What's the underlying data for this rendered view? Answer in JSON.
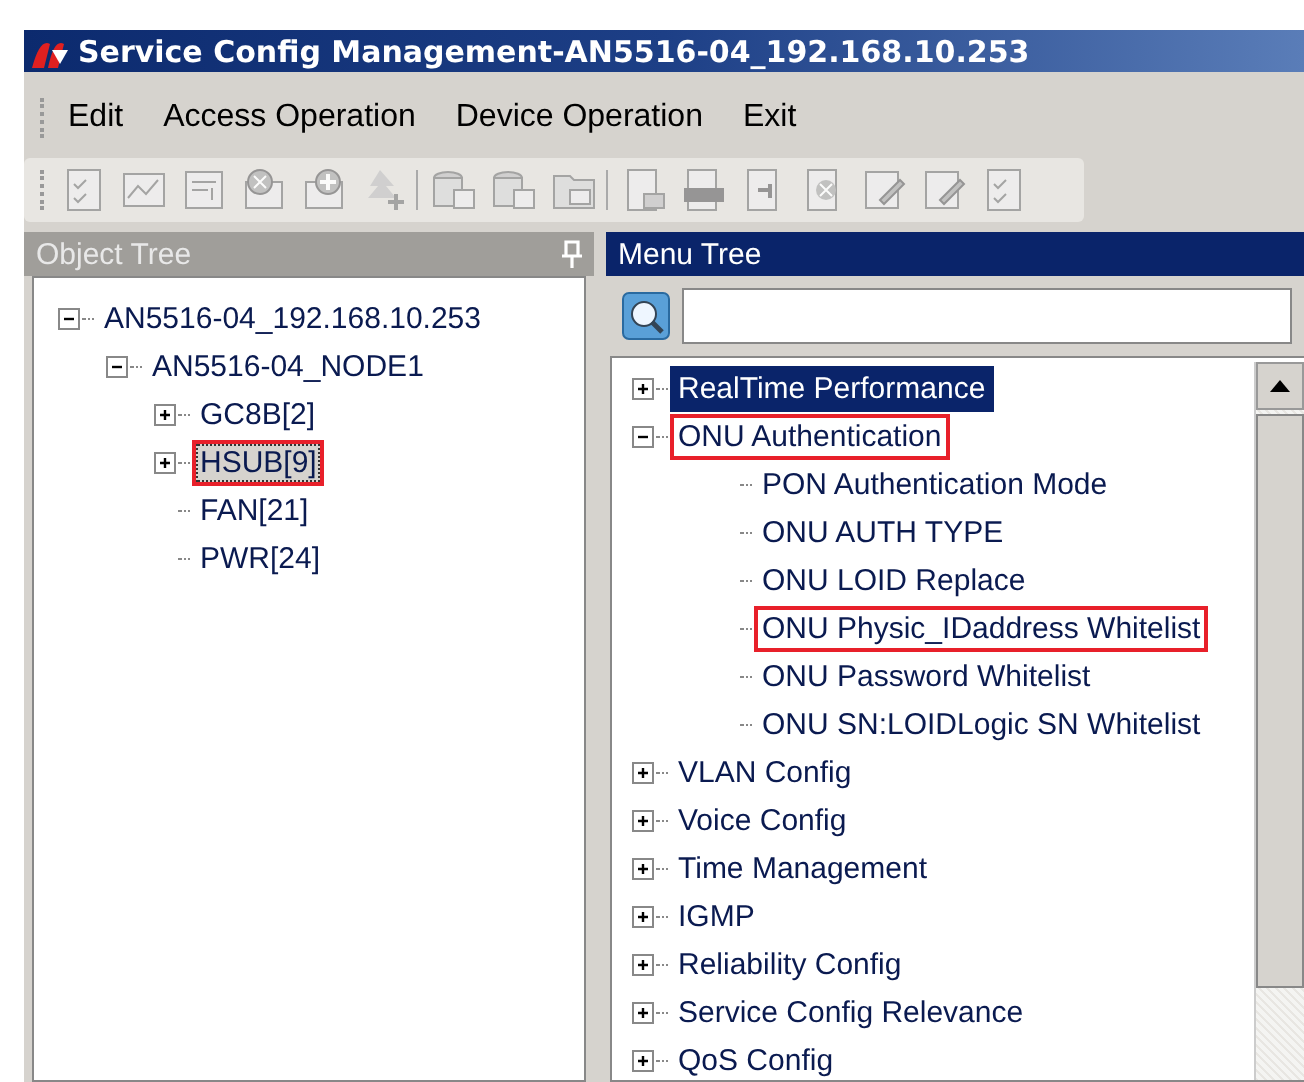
{
  "window": {
    "title": "Service Config Management-AN5516-04_192.168.10.253"
  },
  "menu": [
    "Edit",
    "Access Operation",
    "Device Operation",
    "Exit"
  ],
  "object_tree": {
    "title": "Object Tree",
    "active": false,
    "items": [
      {
        "label": "AN5516-04_192.168.10.253",
        "expanded": true,
        "selected": false,
        "marked": false,
        "children": [
          {
            "label": "AN5516-04_NODE1",
            "expanded": true,
            "selected": false,
            "marked": false,
            "children": [
              {
                "label": "GC8B[2]",
                "expanded": false,
                "selected": false,
                "marked": false
              },
              {
                "label": "HSUB[9]",
                "expanded": false,
                "selected": true,
                "marked": true
              },
              {
                "label": "FAN[21]",
                "selected": false,
                "marked": false
              },
              {
                "label": "PWR[24]",
                "selected": false,
                "marked": false
              }
            ]
          }
        ]
      }
    ]
  },
  "menu_tree": {
    "title": "Menu Tree",
    "active": true,
    "items": [
      {
        "label": "RealTime Performance",
        "expanded": false,
        "selected": true,
        "marked": false
      },
      {
        "label": "ONU Authentication",
        "expanded": true,
        "selected": false,
        "marked": true,
        "children": [
          {
            "label": "PON Authentication Mode",
            "selected": false,
            "marked": false
          },
          {
            "label": "ONU AUTH TYPE",
            "selected": false,
            "marked": false
          },
          {
            "label": "ONU LOID Replace",
            "selected": false,
            "marked": false
          },
          {
            "label": "ONU Physic_IDaddress Whitelist",
            "selected": false,
            "marked": true
          },
          {
            "label": "ONU Password Whitelist",
            "selected": false,
            "marked": false
          },
          {
            "label": "ONU SN:LOIDLogic SN Whitelist",
            "selected": false,
            "marked": false
          }
        ]
      },
      {
        "label": "VLAN Config",
        "expanded": false,
        "selected": false,
        "marked": false
      },
      {
        "label": "Voice Config",
        "expanded": false,
        "selected": false,
        "marked": false
      },
      {
        "label": "Time Management",
        "expanded": false,
        "selected": false,
        "marked": false
      },
      {
        "label": "IGMP",
        "expanded": false,
        "selected": false,
        "marked": false
      },
      {
        "label": "Reliability Config",
        "expanded": false,
        "selected": false,
        "marked": false
      },
      {
        "label": "Service Config Relevance",
        "expanded": false,
        "selected": false,
        "marked": false
      },
      {
        "label": "QoS Config",
        "expanded": false,
        "selected": false,
        "marked": false
      }
    ]
  }
}
